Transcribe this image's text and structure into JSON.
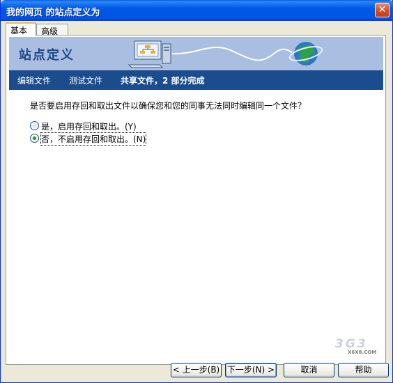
{
  "window": {
    "title": "我的网页 的站点定义为",
    "close_label": "✕"
  },
  "tabs": [
    {
      "label": "基本"
    },
    {
      "label": "高级"
    }
  ],
  "banner": {
    "title": "站点定义"
  },
  "steps": [
    {
      "label": "编辑文件"
    },
    {
      "label": "测试文件"
    },
    {
      "label": "共享文件，2 部分完成"
    }
  ],
  "question": "是否要启用存回和取出文件以确保您和您的同事无法同时编辑同一个文件？",
  "options": [
    {
      "label": "是，启用存回和取出。(Y)",
      "selected": false
    },
    {
      "label": "否，不启用存回和取出。(N)",
      "selected": true
    }
  ],
  "buttons": {
    "back": "< 上一步(B)",
    "next": "下一步(N) >",
    "cancel": "取消",
    "help": "帮助"
  },
  "watermark": {
    "text": "3G3",
    "sub": "X6X8.COM"
  },
  "colors": {
    "title_bar": "#0054e3",
    "banner_bg": "#a9bee0",
    "steps_bg": "#1b4c8e"
  }
}
